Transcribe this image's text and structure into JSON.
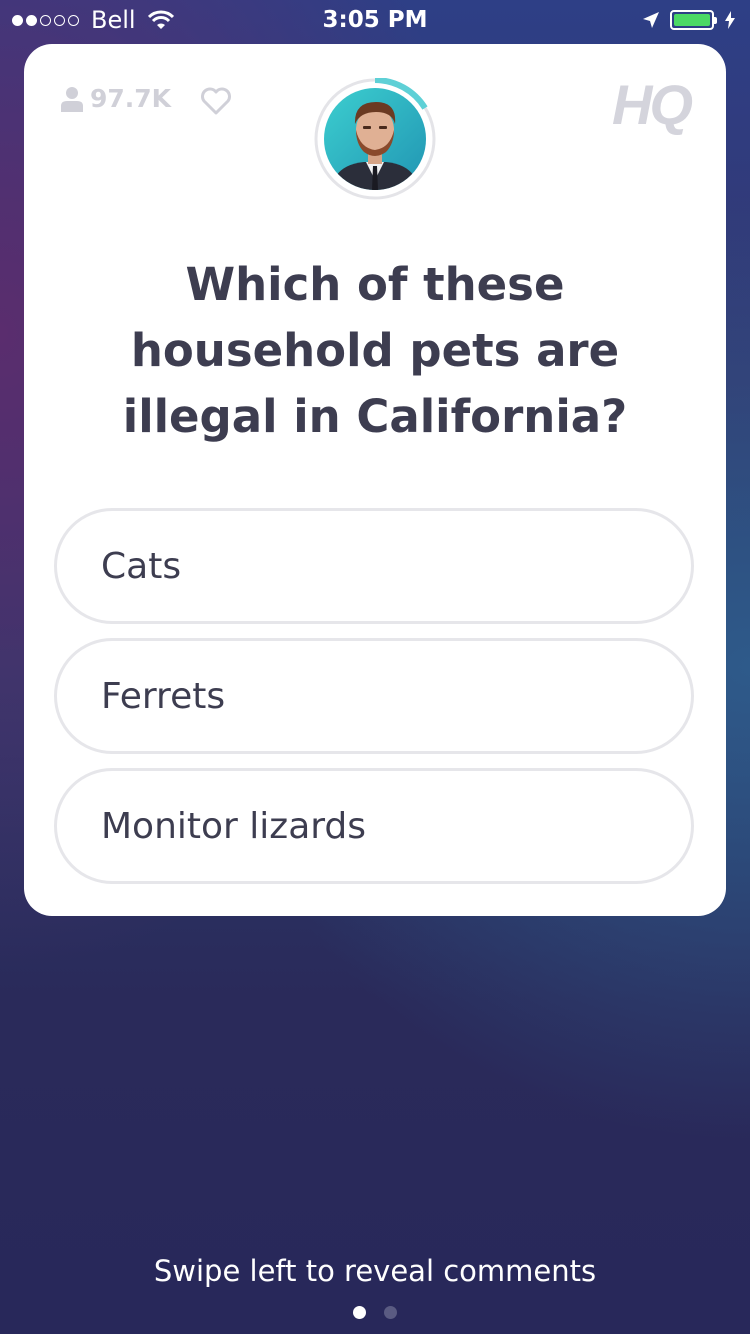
{
  "status_bar": {
    "signal_filled": 2,
    "signal_total": 5,
    "carrier": "Bell",
    "time": "3:05 PM",
    "battery_color": "#4cd964"
  },
  "card": {
    "viewer_count": "97.7K",
    "logo": "HQ",
    "timer_accent": "#5ed0d6",
    "question": "Which of these household pets are illegal in California?",
    "options": [
      {
        "label": "Cats"
      },
      {
        "label": "Ferrets"
      },
      {
        "label": "Monitor lizards"
      }
    ]
  },
  "footer": {
    "hint": "Swipe left to reveal comments",
    "page_count": 2,
    "active_page": 1
  },
  "icons": [
    "wifi-icon",
    "location-icon",
    "battery-icon",
    "charge-icon",
    "person-icon",
    "heart-icon",
    "host-avatar"
  ]
}
